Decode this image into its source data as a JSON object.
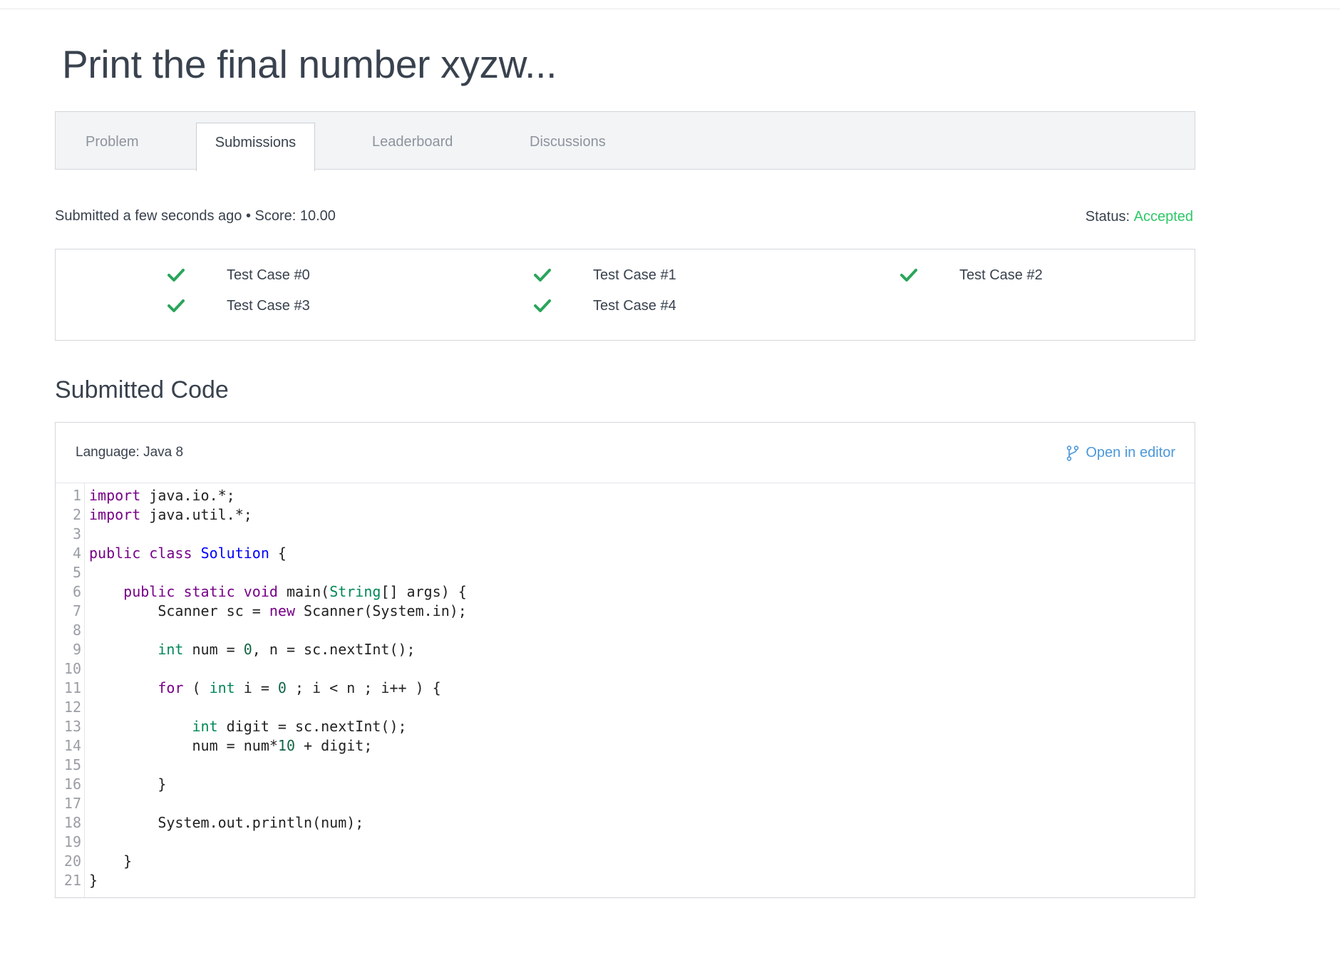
{
  "page": {
    "title": "Print the final number xyzw..."
  },
  "tabs": [
    {
      "label": "Problem",
      "active": false
    },
    {
      "label": "Submissions",
      "active": true
    },
    {
      "label": "Leaderboard",
      "active": false
    },
    {
      "label": "Discussions",
      "active": false
    }
  ],
  "submission": {
    "meta": "Submitted a few seconds ago • Score: 10.00",
    "status_label": "Status:",
    "status_value": "Accepted"
  },
  "test_cases": [
    {
      "label": "Test Case #0",
      "passed": true
    },
    {
      "label": "Test Case #1",
      "passed": true
    },
    {
      "label": "Test Case #2",
      "passed": true
    },
    {
      "label": "Test Case #3",
      "passed": true
    },
    {
      "label": "Test Case #4",
      "passed": true
    }
  ],
  "code_section": {
    "heading": "Submitted Code",
    "language": "Language: Java 8",
    "open_editor": "Open in editor",
    "lines": [
      {
        "n": "1",
        "text": "import java.io.*;"
      },
      {
        "n": "2",
        "text": "import java.util.*;"
      },
      {
        "n": "3",
        "text": ""
      },
      {
        "n": "4",
        "text": "public class Solution {"
      },
      {
        "n": "5",
        "text": ""
      },
      {
        "n": "6",
        "text": "    public static void main(String[] args) {"
      },
      {
        "n": "7",
        "text": "        Scanner sc = new Scanner(System.in);"
      },
      {
        "n": "8",
        "text": ""
      },
      {
        "n": "9",
        "text": "        int num = 0, n = sc.nextInt();"
      },
      {
        "n": "10",
        "text": ""
      },
      {
        "n": "11",
        "text": "        for ( int i = 0 ; i < n ; i++ ) {"
      },
      {
        "n": "12",
        "text": ""
      },
      {
        "n": "13",
        "text": "            int digit = sc.nextInt();"
      },
      {
        "n": "14",
        "text": "            num = num*10 + digit;"
      },
      {
        "n": "15",
        "text": ""
      },
      {
        "n": "16",
        "text": "        }"
      },
      {
        "n": "17",
        "text": ""
      },
      {
        "n": "18",
        "text": "        System.out.println(num);"
      },
      {
        "n": "19",
        "text": ""
      },
      {
        "n": "20",
        "text": "    }"
      },
      {
        "n": "21",
        "text": "}"
      }
    ]
  },
  "colors": {
    "accepted": "#2ec866",
    "check": "#2aa55a",
    "link": "#4b98da",
    "keyword": "#770088",
    "type": "#008855",
    "class_name": "#0000ff",
    "number": "#116644"
  },
  "icons": {
    "check": "check-icon",
    "editor": "branch-icon"
  }
}
